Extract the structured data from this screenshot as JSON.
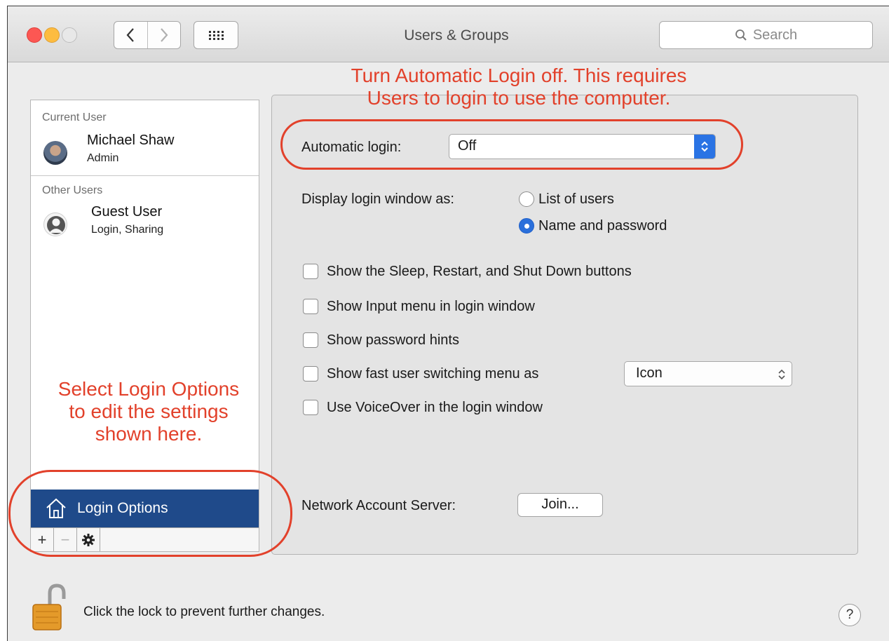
{
  "window": {
    "title": "Users & Groups",
    "search_placeholder": "Search",
    "nav_back": "‹",
    "nav_forward": "›"
  },
  "sidebar": {
    "current_user_label": "Current User",
    "current_user": {
      "name": "Michael Shaw",
      "role": "Admin"
    },
    "other_users_label": "Other Users",
    "other_users": [
      {
        "name": "Guest User",
        "role": "Login, Sharing"
      }
    ],
    "login_options_label": "Login Options",
    "toolbar": {
      "add": "+",
      "remove": "−"
    }
  },
  "login_panel": {
    "automatic_login_label": "Automatic login:",
    "automatic_login_value": "Off",
    "display_login_label": "Display login window as:",
    "display_options": [
      {
        "label": "List of users",
        "selected": false
      },
      {
        "label": "Name and password",
        "selected": true
      }
    ],
    "checkboxes": [
      {
        "label": "Show the Sleep, Restart, and Shut Down buttons",
        "checked": false
      },
      {
        "label": "Show Input menu in login window",
        "checked": false
      },
      {
        "label": "Show password hints",
        "checked": false
      },
      {
        "label": "Show fast user switching menu as",
        "checked": false
      },
      {
        "label": "Use VoiceOver in the login window",
        "checked": false
      }
    ],
    "fast_user_switching_value": "Icon",
    "network_server_label": "Network Account Server:",
    "join_button": "Join..."
  },
  "footer": {
    "lock_text": "Click the lock to prevent further changes.",
    "help": "?"
  },
  "annotations": {
    "top_line1": "Turn Automatic Login off. This requires",
    "top_line2": "Users to login to use the computer.",
    "left_line1": "Select Login Options",
    "left_line2": "to edit the settings",
    "left_line3": "shown here."
  },
  "colors": {
    "annotation": "#e2412b",
    "selection": "#1f4a8a",
    "accent": "#2a73e4"
  }
}
